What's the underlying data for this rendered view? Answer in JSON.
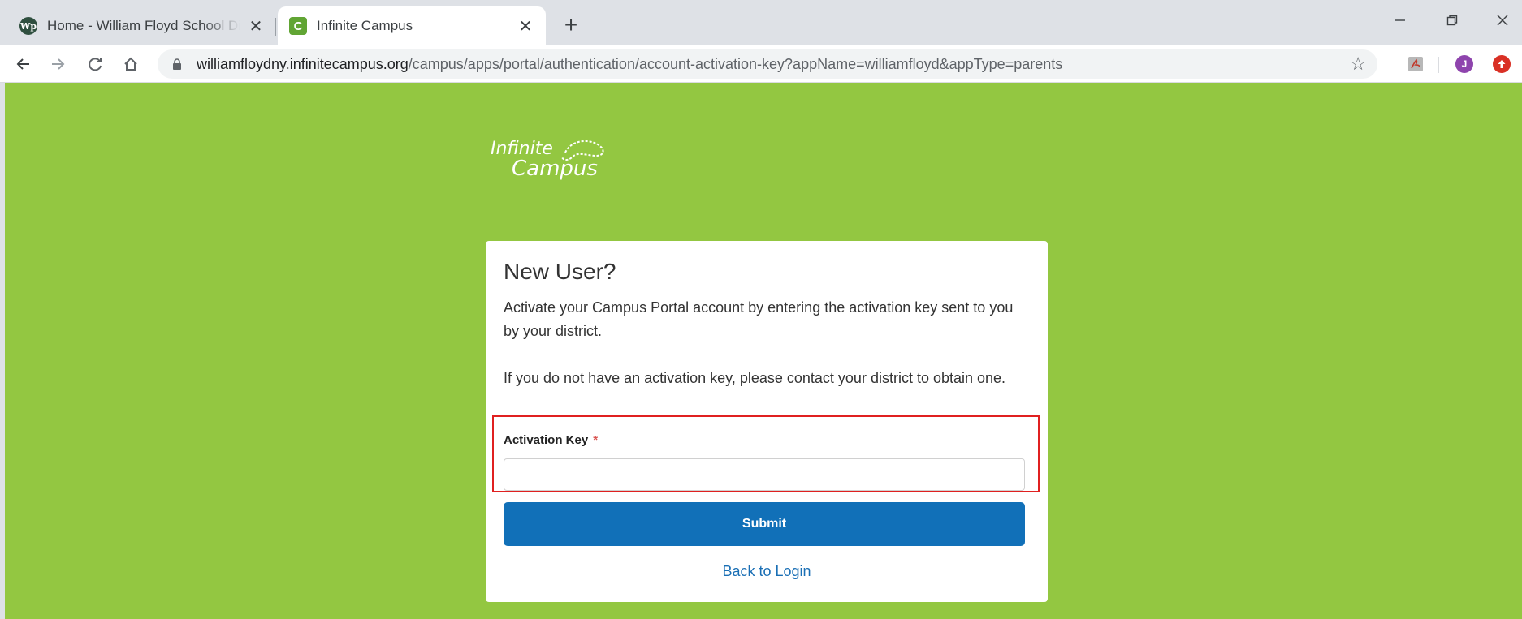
{
  "browser": {
    "tabs": [
      {
        "title": "Home - William Floyd School District",
        "favicon": "wp-icon",
        "active": false
      },
      {
        "title": "Infinite Campus",
        "favicon": "C",
        "active": true
      }
    ],
    "url_host": "williamfloydny.infinitecampus.org",
    "url_path": "/campus/apps/portal/authentication/account-activation-key?appName=williamfloyd&appType=parents",
    "profile_initial": "J",
    "favicon_wp_text": "Wp"
  },
  "page": {
    "background_color": "#93c741",
    "logo": {
      "line1": "Infinite",
      "line2": "Campus"
    },
    "card": {
      "title": "New User?",
      "paragraph1": "Activate your Campus Portal account by entering the activation key sent to you by your district.",
      "paragraph2": "If you do not have an activation key, please contact your district to obtain one.",
      "field_label": "Activation Key",
      "required_marker": "*",
      "field_value": "",
      "submit_label": "Submit",
      "back_link": "Back to Login"
    }
  },
  "colors": {
    "accent_button": "#1170b8",
    "link": "#1a6fb5",
    "highlight_border": "#e02020"
  }
}
